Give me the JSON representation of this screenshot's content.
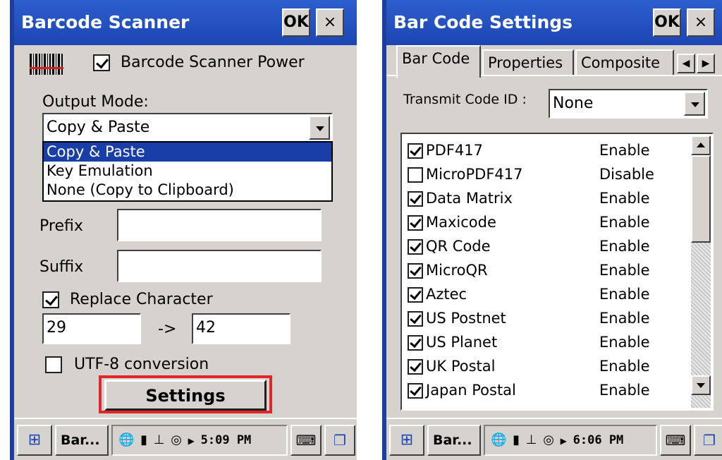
{
  "left": {
    "title": "Barcode Scanner",
    "ok_label": "OK",
    "close_label": "×",
    "power_label": "Barcode Scanner Power",
    "power_checked": true,
    "output_mode_label": "Output Mode:",
    "output_mode_value": "Copy & Paste",
    "output_mode_options": [
      "Copy & Paste",
      "Key Emulation",
      "None (Copy to Clipboard)"
    ],
    "prefix_label": "Prefix",
    "prefix_value": "",
    "suffix_label": "Suffix",
    "suffix_value": "",
    "replace_label": "Replace Character",
    "replace_checked": true,
    "replace_from": "29",
    "replace_arrow": "->",
    "replace_to": "42",
    "utf8_label": "UTF-8 conversion",
    "utf8_checked": false,
    "settings_label": "Settings",
    "taskbar": {
      "app": "Bar...",
      "time": "5:09 PM"
    }
  },
  "right": {
    "title": "Bar Code Settings",
    "ok_label": "OK",
    "close_label": "×",
    "tabs": [
      "Bar Code",
      "Properties",
      "Composite"
    ],
    "transmit_label": "Transmit Code ID :",
    "transmit_value": "None",
    "symbologies": [
      {
        "name": "PDF417",
        "status": "Enable",
        "checked": true
      },
      {
        "name": "MicroPDF417",
        "status": "Disable",
        "checked": false
      },
      {
        "name": "Data Matrix",
        "status": "Enable",
        "checked": true
      },
      {
        "name": "Maxicode",
        "status": "Enable",
        "checked": true
      },
      {
        "name": "QR Code",
        "status": "Enable",
        "checked": true
      },
      {
        "name": "MicroQR",
        "status": "Enable",
        "checked": true
      },
      {
        "name": "Aztec",
        "status": "Enable",
        "checked": true
      },
      {
        "name": "US Postnet",
        "status": "Enable",
        "checked": true
      },
      {
        "name": "US Planet",
        "status": "Enable",
        "checked": true
      },
      {
        "name": "UK Postal",
        "status": "Enable",
        "checked": true
      },
      {
        "name": "Japan Postal",
        "status": "Enable",
        "checked": true
      }
    ],
    "taskbar": {
      "app": "Bar...",
      "time": "6:06 PM"
    }
  },
  "colors": {
    "titlebar": "#1c45b2",
    "highlight": "#1a3ea8",
    "focus_outline": "#e0262b",
    "window": "#d6d3ce"
  },
  "icons": [
    "barcode-icon",
    "windows-start-icon",
    "globe-icon",
    "signal-icon",
    "connection-icon",
    "sync-icon",
    "keyboard-icon",
    "task-switch-icon"
  ]
}
